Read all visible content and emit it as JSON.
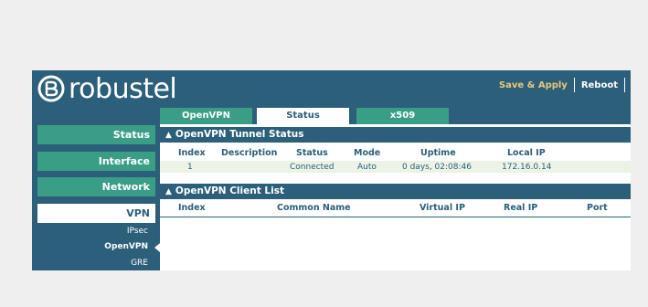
{
  "header": {
    "brand": "robustel",
    "save_apply": "Save & Apply",
    "reboot": "Reboot"
  },
  "tabs": [
    {
      "label": "OpenVPN",
      "active": false
    },
    {
      "label": "Status",
      "active": true
    },
    {
      "label": "x509",
      "active": false
    }
  ],
  "sidebar": {
    "items": [
      {
        "label": "Status",
        "active": false
      },
      {
        "label": "Interface",
        "active": false
      },
      {
        "label": "Network",
        "active": false
      },
      {
        "label": "VPN",
        "active": true
      }
    ],
    "subitems": [
      {
        "label": "IPsec",
        "active": false
      },
      {
        "label": "OpenVPN",
        "active": true
      },
      {
        "label": "GRE",
        "active": false
      }
    ]
  },
  "tunnel_status": {
    "title": "OpenVPN Tunnel Status",
    "columns": [
      "Index",
      "Description",
      "Status",
      "Mode",
      "Uptime",
      "Local IP"
    ],
    "rows": [
      {
        "index": "1",
        "description": "",
        "status": "Connected",
        "mode": "Auto",
        "uptime": "0 days, 02:08:46",
        "local_ip": "172.16.0.14"
      }
    ]
  },
  "client_list": {
    "title": "OpenVPN Client List",
    "columns": [
      "Index",
      "Common Name",
      "Virtual IP",
      "Real IP",
      "Port"
    ]
  },
  "colors": {
    "primary": "#2b5f7a",
    "accent": "#3a9e86",
    "row_highlight": "#eaf3e6",
    "save_text": "#e8c87a"
  }
}
